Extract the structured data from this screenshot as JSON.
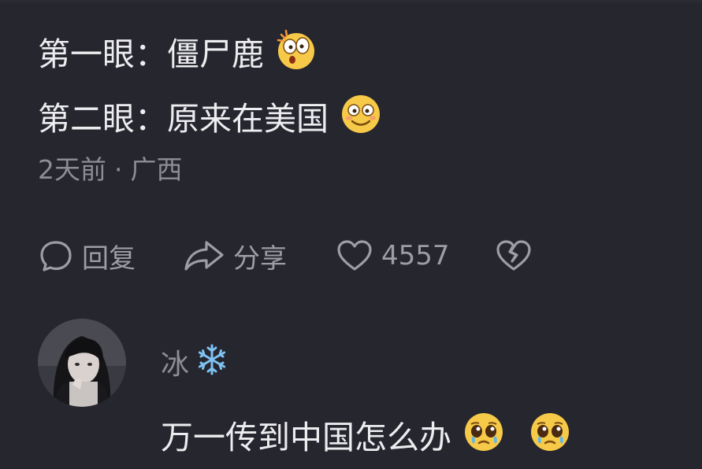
{
  "comment": {
    "line1": "第一眼：僵尸鹿",
    "line1_emoji": "astonished-face-icon",
    "line2": "第二眼：原来在美国",
    "line2_emoji": "smiling-face-icon",
    "time": "2天前",
    "separator": "·",
    "location": "广西"
  },
  "actions": {
    "reply_label": "回复",
    "share_label": "分享",
    "like_count": "4557"
  },
  "reply": {
    "username": "冰",
    "username_emoji": "snowflake-icon",
    "text": "万一传到中国怎么办",
    "text_emojis": [
      "pleading-face-icon",
      "pleading-face-icon"
    ]
  },
  "colors": {
    "background": "#26262f",
    "text_primary": "#ededf0",
    "text_secondary": "#8d8d96",
    "emoji_yellow": "#f7c948",
    "snowflake_blue": "#7ec3f2"
  }
}
